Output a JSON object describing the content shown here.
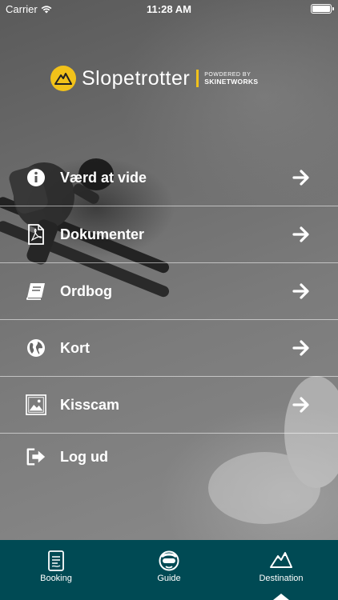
{
  "status_bar": {
    "carrier": "Carrier",
    "time": "11:28 AM"
  },
  "logo": {
    "name": "Slopetrotter",
    "powered_line1": "POWDERED BY",
    "powered_line2": "SKINETWORKS",
    "accent": "#f2c21a"
  },
  "menu": {
    "items": [
      {
        "label": "Værd at vide",
        "icon": "info-icon"
      },
      {
        "label": "Dokumenter",
        "icon": "pdf-document-icon"
      },
      {
        "label": "Ordbog",
        "icon": "book-icon"
      },
      {
        "label": "Kort",
        "icon": "globe-icon"
      },
      {
        "label": "Kisscam",
        "icon": "image-icon"
      },
      {
        "label": "Log ud",
        "icon": "logout-icon"
      }
    ]
  },
  "tabbar": {
    "background": "#004a54",
    "tabs": [
      {
        "label": "Booking",
        "icon": "booking-document-icon"
      },
      {
        "label": "Guide",
        "icon": "guide-face-icon"
      },
      {
        "label": "Destination",
        "icon": "mountain-icon",
        "selected": true
      }
    ]
  }
}
